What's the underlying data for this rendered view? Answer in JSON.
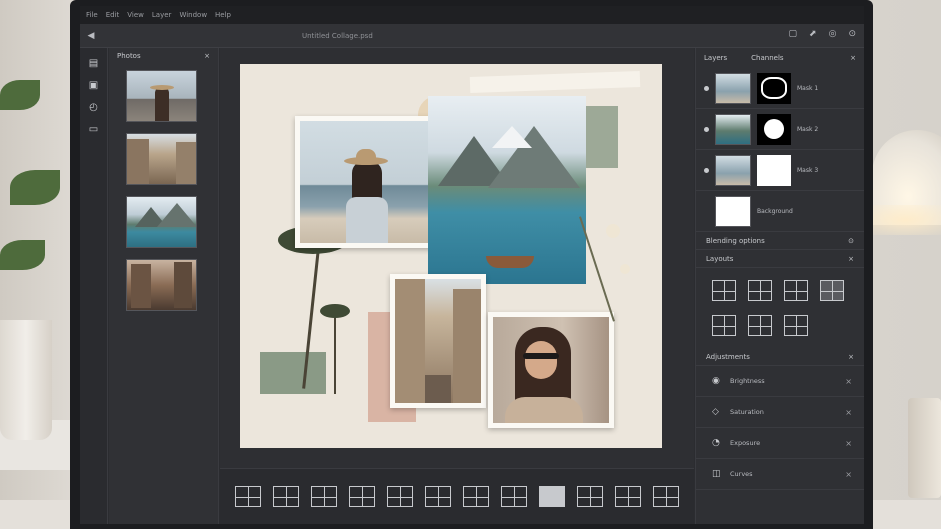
{
  "titlebar": {
    "items": [
      "File",
      "Edit",
      "View",
      "Layer",
      "Window",
      "Help"
    ],
    "path": "Untitled Collage.psd"
  },
  "toolbar": {
    "icons": [
      "back-icon",
      "layers-icon",
      "share-icon",
      "settings-icon",
      "more-icon"
    ]
  },
  "thumbs_panel": {
    "title": "Photos",
    "close": "×",
    "items": [
      "woman-hat-city",
      "street-buildings",
      "mountain-lake",
      "city-street-evening"
    ]
  },
  "layers_panel": {
    "tabs": [
      "Layers",
      "Channels"
    ],
    "close": "×",
    "layers": [
      {
        "name": "Mask 1",
        "mask": "blob"
      },
      {
        "name": "Mask 2",
        "mask": "circle"
      },
      {
        "name": "Mask 3",
        "mask": "white"
      },
      {
        "name": "Background",
        "mask": "none"
      }
    ],
    "footer": "Blending options"
  },
  "layouts_section": {
    "title": "Layouts",
    "close": "×",
    "count": 8
  },
  "adjustments_section": {
    "title": "Adjustments",
    "close": "×",
    "items": [
      {
        "label": "Brightness",
        "icon": "circle-icon"
      },
      {
        "label": "Saturation",
        "icon": "diamond-icon"
      },
      {
        "label": "Exposure",
        "icon": "drop-icon"
      },
      {
        "label": "Curves",
        "icon": "curve-icon"
      }
    ]
  },
  "layout_bar": {
    "count": 12
  }
}
